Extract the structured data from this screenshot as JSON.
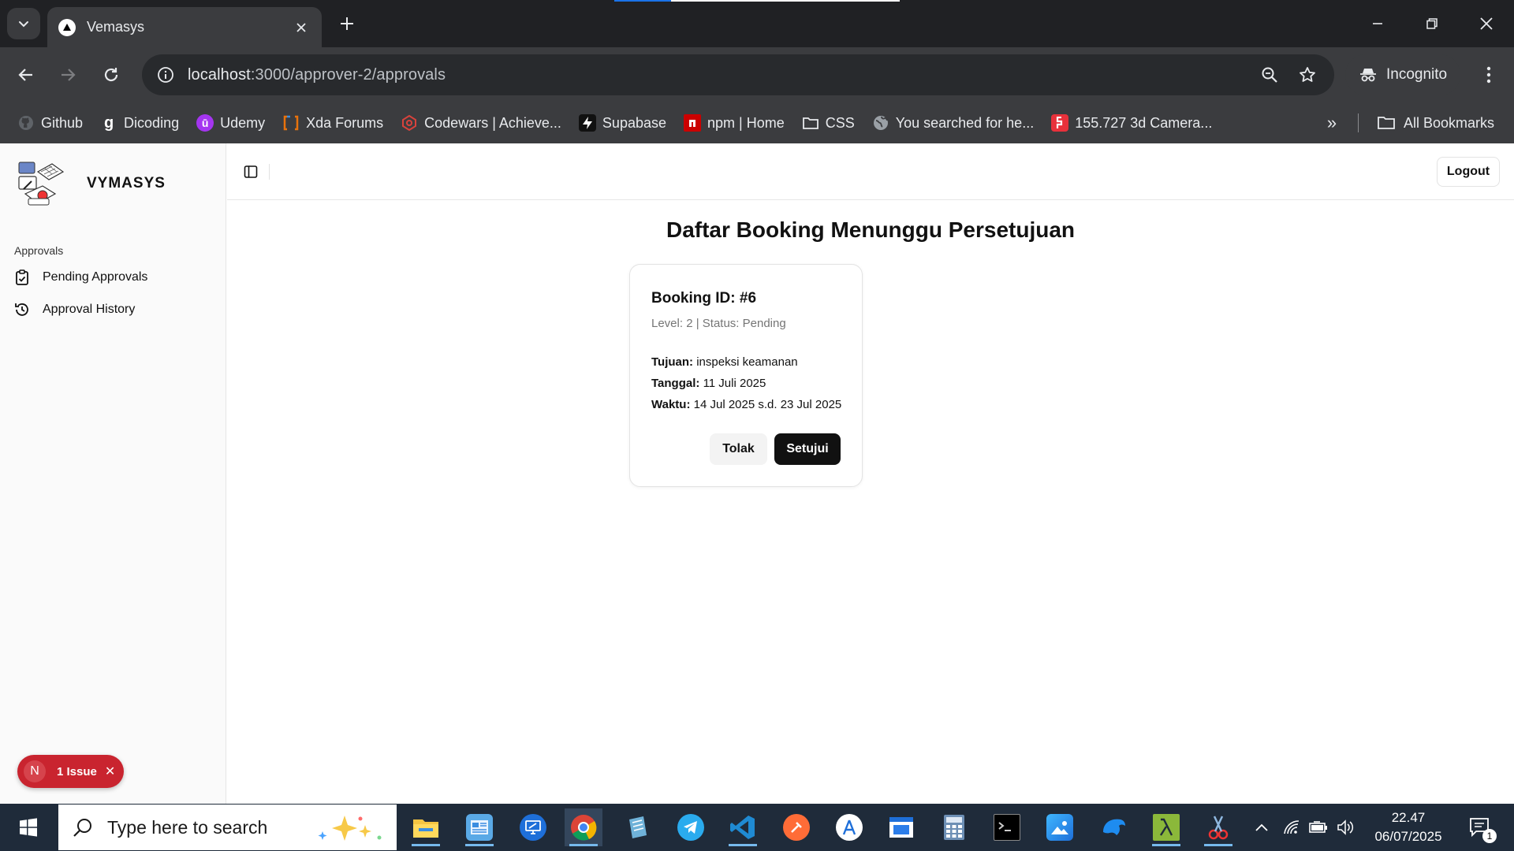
{
  "browser": {
    "tab_title": "Vemasys",
    "url_host": "localhost",
    "url_rest": ":3000/approver-2/approvals",
    "incognito_label": "Incognito",
    "bookmarks": [
      {
        "label": "Github",
        "icon": "github-icon"
      },
      {
        "label": "Dicoding",
        "icon": "dicoding-icon"
      },
      {
        "label": "Udemy",
        "icon": "udemy-icon"
      },
      {
        "label": "Xda Forums",
        "icon": "xda-icon"
      },
      {
        "label": "Codewars | Achieve...",
        "icon": "codewars-icon"
      },
      {
        "label": "Supabase",
        "icon": "supabase-icon"
      },
      {
        "label": "npm | Home",
        "icon": "npm-icon"
      },
      {
        "label": "CSS",
        "icon": "folder-icon"
      },
      {
        "label": "You searched for he...",
        "icon": "globe-icon"
      },
      {
        "label": "155.727 3d Camera...",
        "icon": "camera-site-icon"
      }
    ],
    "all_bookmarks_label": "All Bookmarks"
  },
  "app": {
    "brand_name": "VYMASYS",
    "sidebar": {
      "group_label": "Approvals",
      "items": [
        {
          "label": "Pending Approvals",
          "icon": "clipboard-check-icon"
        },
        {
          "label": "Approval History",
          "icon": "history-icon"
        }
      ]
    },
    "logout_label": "Logout",
    "page_title": "Daftar Booking Menunggu Persetujuan",
    "booking": {
      "title": "Booking ID: #6",
      "meta": "Level: 2 | Status: Pending",
      "tujuan_label": "Tujuan:",
      "tujuan_value": "inspeksi keamanan",
      "tanggal_label": "Tanggal:",
      "tanggal_value": "11 Juli 2025",
      "waktu_label": "Waktu:",
      "waktu_value": "14 Jul 2025 s.d. 23 Jul 2025",
      "reject_label": "Tolak",
      "approve_label": "Setujui"
    },
    "dev_overlay": {
      "badge_letter": "N",
      "issue_label": "1 Issue",
      "close_glyph": "✕"
    }
  },
  "taskbar": {
    "search_placeholder": "Type here to search",
    "time": "22.47",
    "date": "06/07/2025",
    "notification_count": "1",
    "colors": {
      "background": "#1f2b3a",
      "active_indicator": "#76b9ed"
    }
  },
  "colors": {
    "primary_button": "#111111",
    "secondary_button": "#f3f3f3",
    "issue_badge": "#c9242f",
    "chrome_dark": "#202124",
    "chrome_toolbar": "#3b3c3f"
  }
}
